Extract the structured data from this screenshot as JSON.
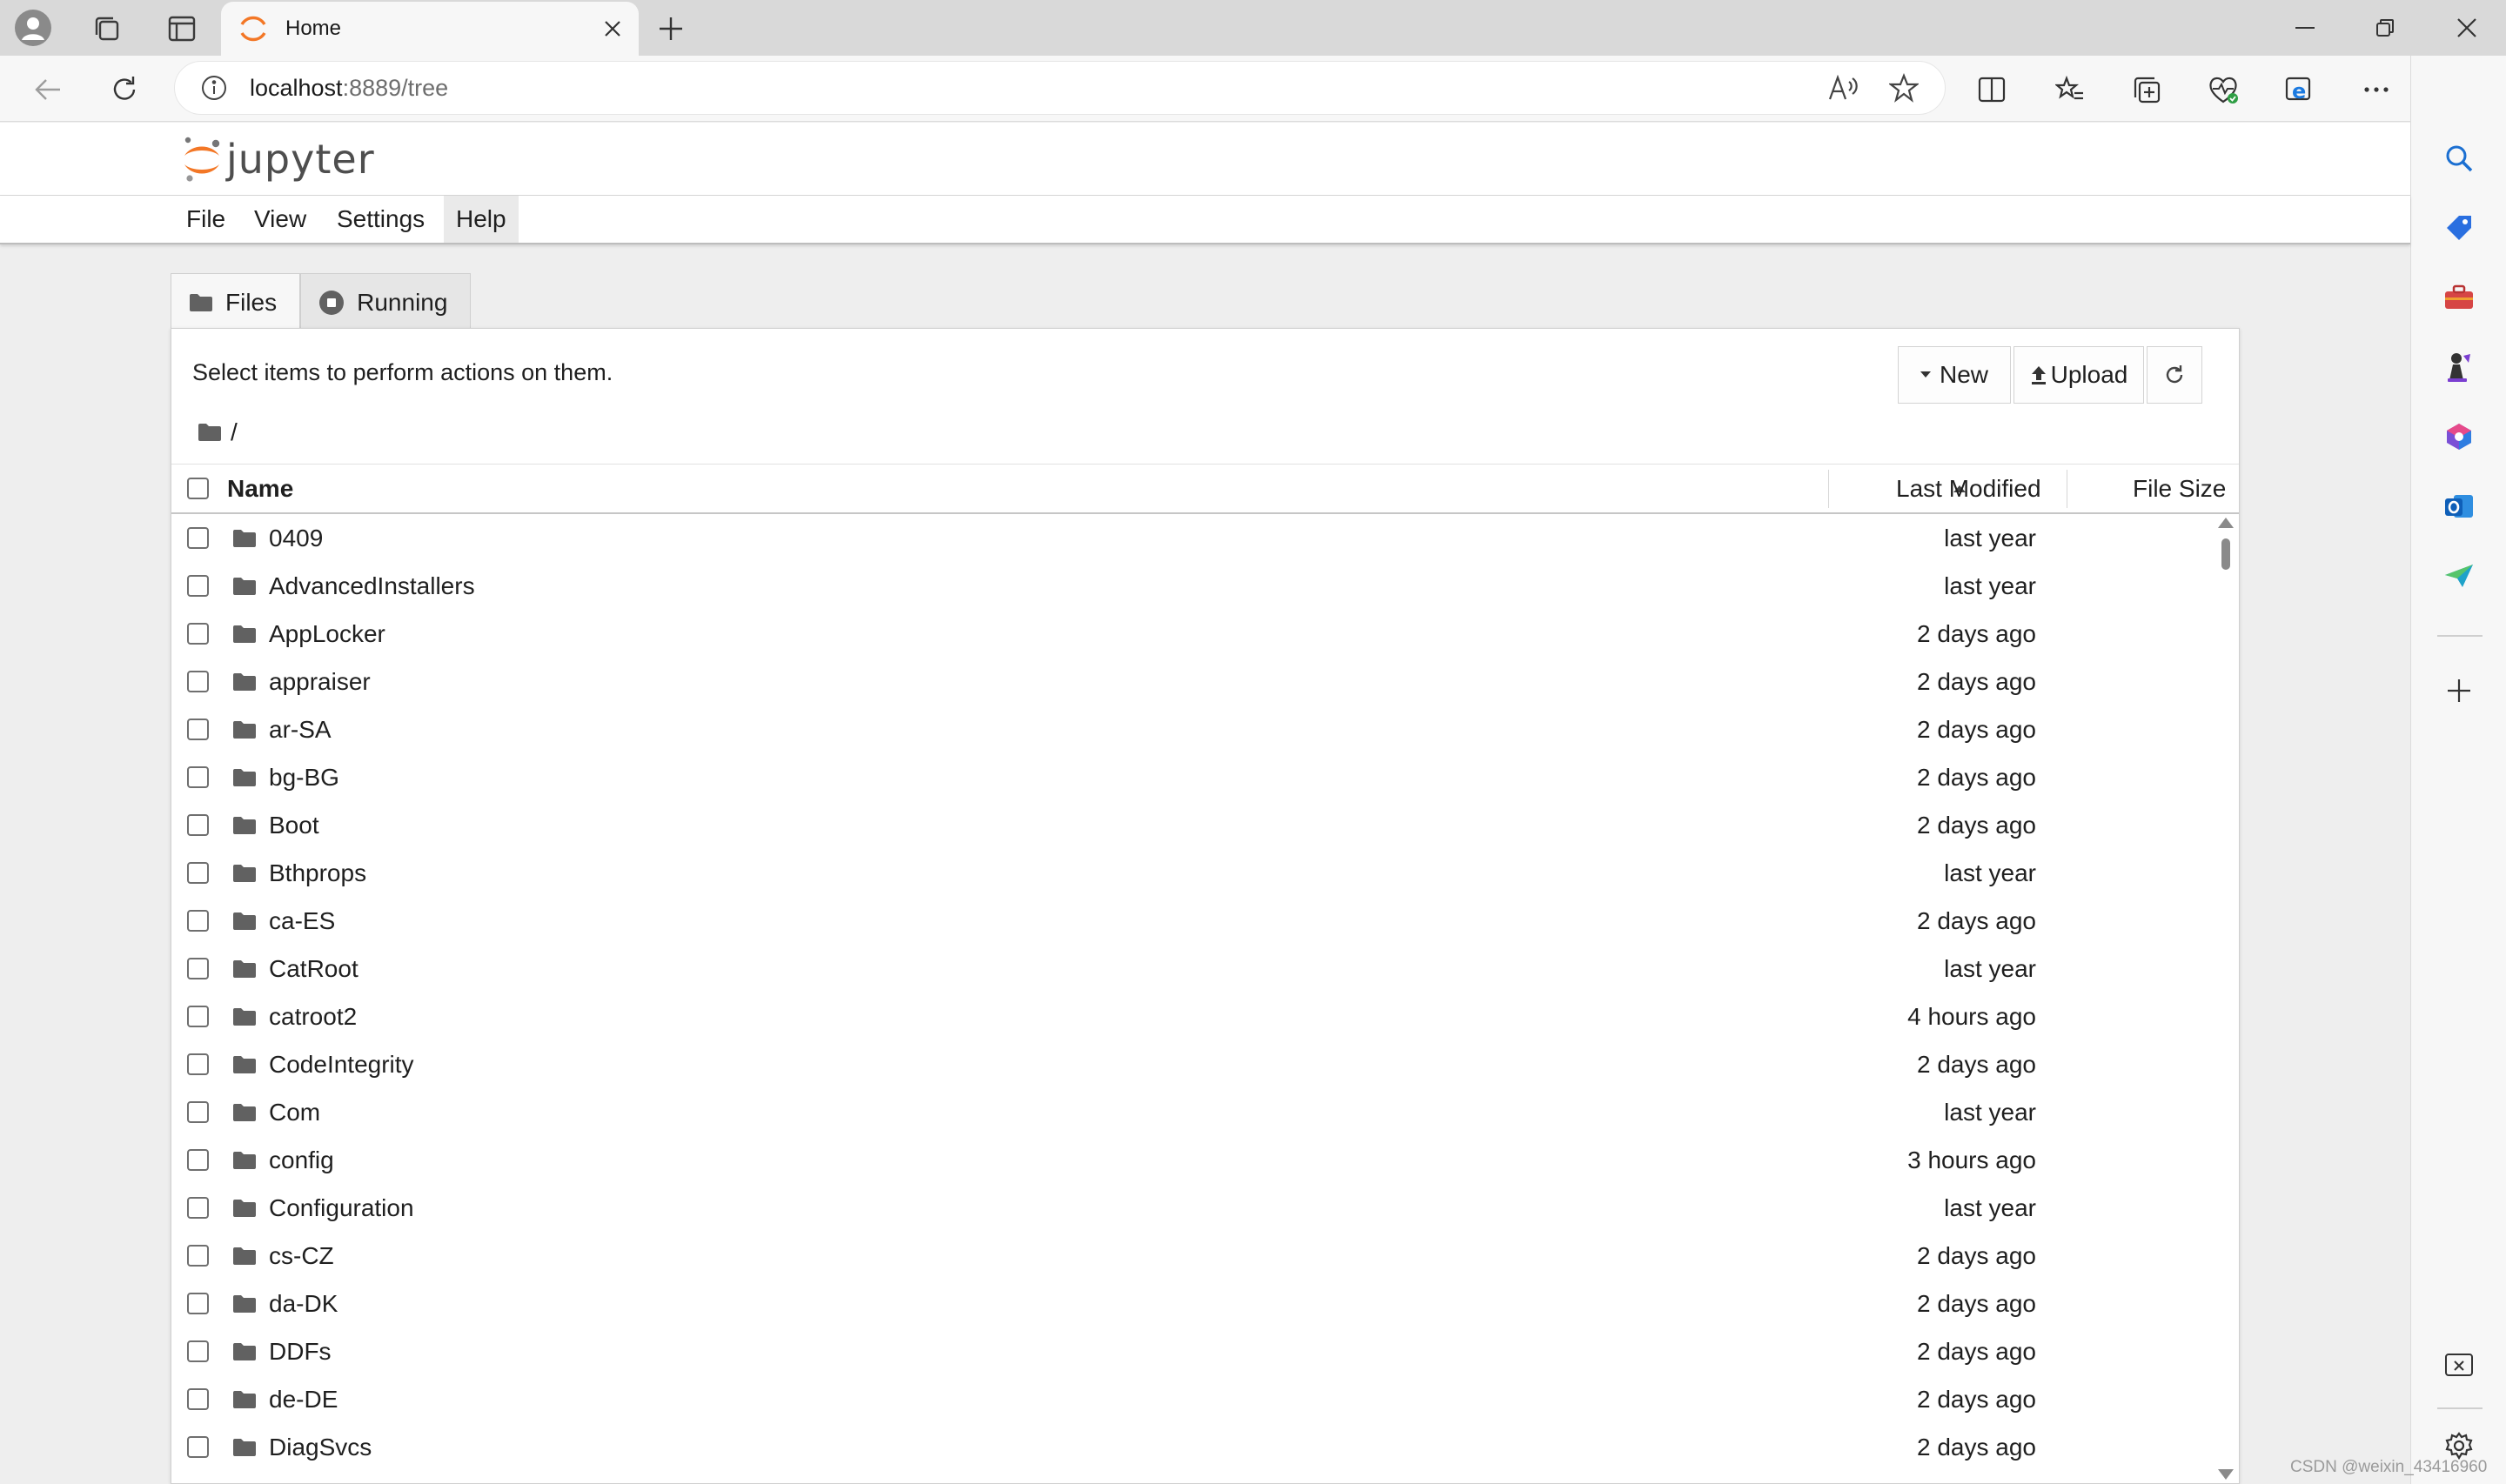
{
  "browser": {
    "tab_title": "Home",
    "url_host": "localhost",
    "url_rest": ":8889/tree"
  },
  "jupyter": {
    "logo_text": "jupyter",
    "menu": [
      "File",
      "View",
      "Settings",
      "Help"
    ],
    "tabs": {
      "files": "Files",
      "running": "Running"
    },
    "toolbar": {
      "message": "Select items to perform actions on them.",
      "new_label": "New",
      "upload_label": "Upload"
    },
    "breadcrumb": "/",
    "columns": {
      "name": "Name",
      "last_modified": "Last Modified",
      "file_size": "File Size"
    },
    "files": [
      {
        "name": "0409",
        "modified": "last year"
      },
      {
        "name": "AdvancedInstallers",
        "modified": "last year"
      },
      {
        "name": "AppLocker",
        "modified": "2 days ago"
      },
      {
        "name": "appraiser",
        "modified": "2 days ago"
      },
      {
        "name": "ar-SA",
        "modified": "2 days ago"
      },
      {
        "name": "bg-BG",
        "modified": "2 days ago"
      },
      {
        "name": "Boot",
        "modified": "2 days ago"
      },
      {
        "name": "Bthprops",
        "modified": "last year"
      },
      {
        "name": "ca-ES",
        "modified": "2 days ago"
      },
      {
        "name": "CatRoot",
        "modified": "last year"
      },
      {
        "name": "catroot2",
        "modified": "4 hours ago"
      },
      {
        "name": "CodeIntegrity",
        "modified": "2 days ago"
      },
      {
        "name": "Com",
        "modified": "last year"
      },
      {
        "name": "config",
        "modified": "3 hours ago"
      },
      {
        "name": "Configuration",
        "modified": "last year"
      },
      {
        "name": "cs-CZ",
        "modified": "2 days ago"
      },
      {
        "name": "da-DK",
        "modified": "2 days ago"
      },
      {
        "name": "DDFs",
        "modified": "2 days ago"
      },
      {
        "name": "de-DE",
        "modified": "2 days ago"
      },
      {
        "name": "DiagSvcs",
        "modified": "2 days ago"
      }
    ]
  },
  "watermark": "CSDN @weixin_43416960",
  "colors": {
    "jupyter_orange": "#f37726",
    "edge_blue": "#0c6cd4"
  }
}
